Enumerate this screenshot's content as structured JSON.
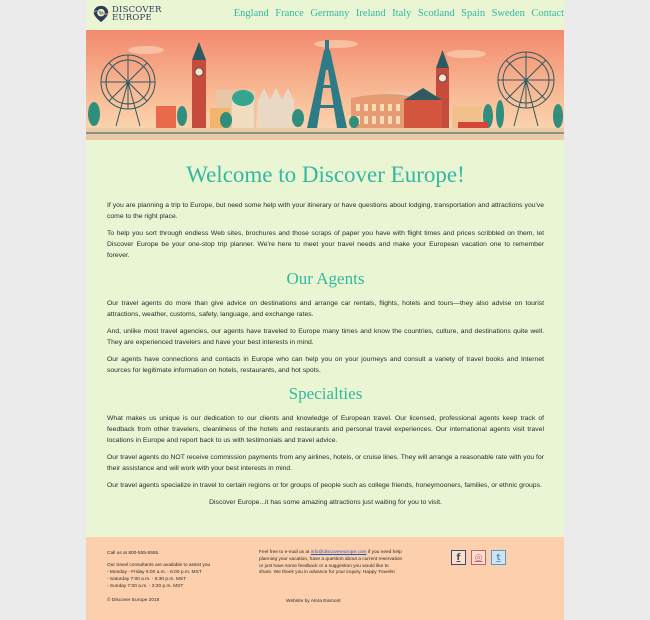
{
  "site": {
    "logo_line1": "DISCOVER",
    "logo_line2": "EUROPE"
  },
  "nav": [
    "England",
    "France",
    "Germany",
    "Ireland",
    "Italy",
    "Scotland",
    "Spain",
    "Sweden",
    "Contact"
  ],
  "main": {
    "title": "Welcome to Discover Europe!",
    "intro": [
      "If you are planning a trip to Europe, but need some help with your itinerary or have questions about lodging, transportation and attractions you've come to the right place.",
      "To help you sort through endless Web sites, brochures and those scraps of paper you have with flight times and prices scribbled on them, let Discover Europe be your one-stop trip planner. We're here to meet your travel needs and make your European vacation one to remember forever."
    ],
    "agents_heading": "Our Agents",
    "agents": [
      "Our travel agents do more than give advice on destinations and arrange car rentals, flights, hotels and tours—they also advise on tourist attractions, weather, customs, safety, language, and exchange rates.",
      "And, unlike most travel agencies, our agents have traveled to Europe many times and know the countries, culture, and destinations quite well. They are experienced travelers and have your best interests in mind.",
      "Our agents have connections and contacts in Europe who can help you on your journeys and consult a variety of travel books and Internet sources for legitimate information on hotels, restaurants, and hot spots."
    ],
    "specialties_heading": "Specialties",
    "specialties": [
      "What makes us unique is our dedication to our clients and knowledge of European travel. Our licensed, professional agents keep track of feedback from other travelers, cleanliness of the hotels and restaurants and personal travel experiences. Our international agents visit travel locations in Europe and report back to us with testimonials and travel advice.",
      "Our travel agents do NOT receive commission payments from any airlines, hotels, or cruise lines. They will arrange a reasonable rate with you for their assistance and will work with your best interests in mind.",
      "Our travel agents specialize in travel to certain regions or for groups of people such as college friends, honeymooners, families, or ethnic groups."
    ],
    "closing": "Discover Europe...it has some amazing attractions just waiting for you to visit."
  },
  "footer": {
    "call": "Call us at 800-555-5555.",
    "hours_title": "Our travel consultants are available to assist you",
    "hours": [
      "- Monday - Friday 6:00 a.m. - 6:00 p.m. MST",
      "- Saturday 7:00 a.m. - 5:30 p.m. MST",
      "- Sunday 7:00 a.m. - 3:30 p.m. MST"
    ],
    "copyright": "© Discover Europe 2018",
    "email_prefix": "Feel free to e-mail us at ",
    "email": "info@discovereurope.com",
    "email_suffix": " if you need help planning your vacation, have a question about a current reservation or just have some feedback or a suggestion you would like to share. We thank you in advance for your inquiry. Happy Travels!",
    "credit": "Website by Alora Eismont",
    "social": [
      "f",
      "◎",
      "t"
    ]
  },
  "colors": {
    "accent": "#35b7a3",
    "page_bg": "#e9f5d3",
    "footer_bg": "#fdd0ad",
    "sky": "#f48d70"
  },
  "hero": {
    "icon": "european-landmarks-skyline-illustration"
  }
}
